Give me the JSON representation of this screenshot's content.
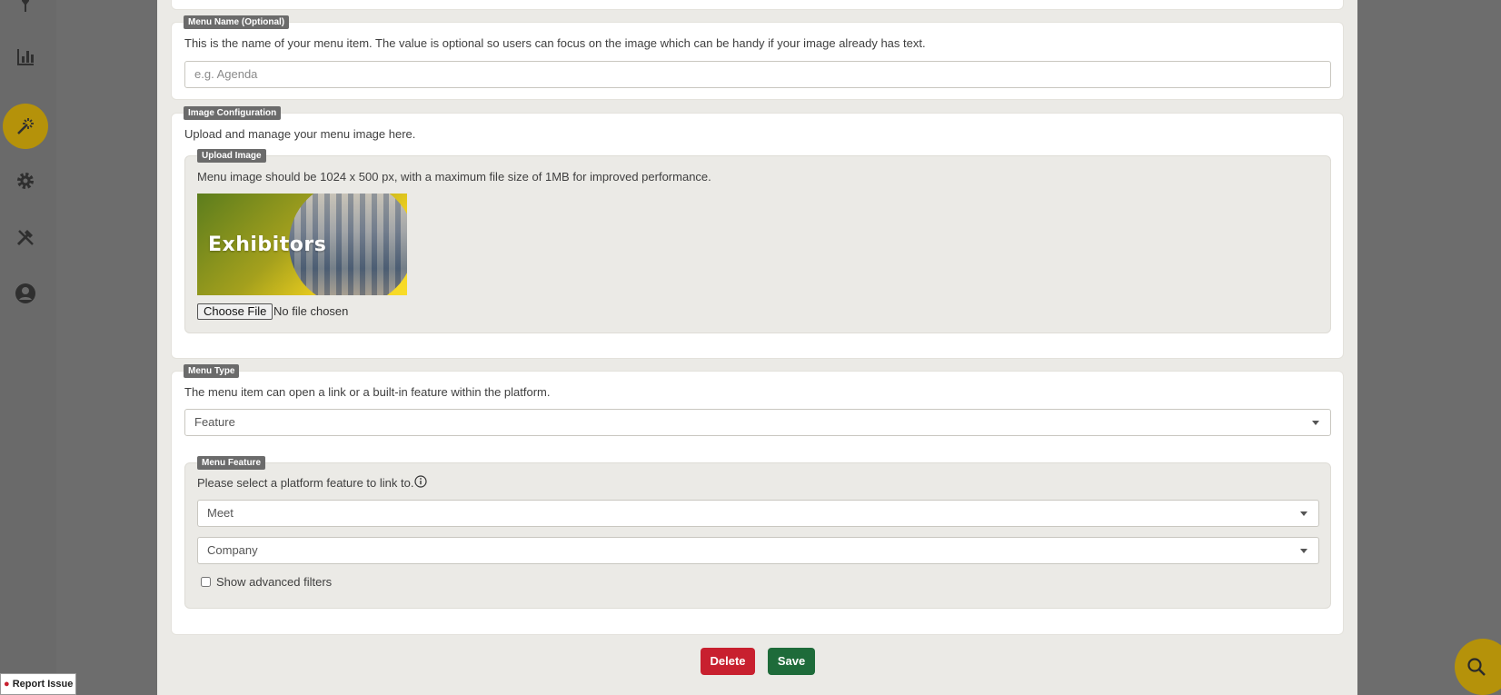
{
  "menu_name": {
    "legend": "Menu Name (Optional)",
    "description": "This is the name of your menu item. The value is optional so users can focus on the image which can be handy if your image already has text.",
    "placeholder": "e.g. Agenda"
  },
  "image_config": {
    "legend": "Image Configuration",
    "description": "Upload and manage your menu image here.",
    "upload": {
      "legend": "Upload Image",
      "description": "Menu image should be 1024 x 500 px, with a maximum file size of 1MB for improved performance.",
      "image_text": "Exhibitors",
      "choose_file_label": "Choose File",
      "file_status": "No file chosen"
    }
  },
  "menu_type": {
    "legend": "Menu Type",
    "description": "The menu item can open a link or a built-in feature within the platform.",
    "selected": "Feature"
  },
  "menu_feature": {
    "legend": "Menu Feature",
    "description": "Please select a platform feature to link to.",
    "feature_selected": "Meet",
    "target_selected": "Company",
    "advanced_filters_label": "Show advanced filters"
  },
  "actions": {
    "delete_label": "Delete",
    "save_label": "Save"
  },
  "report_issue_label": "Report Issue",
  "colors": {
    "accent": "#b5920a",
    "danger": "#c8202f",
    "success": "#1e6b3a"
  },
  "sidebar": {
    "icons": [
      "chart-bar-icon",
      "magic-wand-icon",
      "gear-icon",
      "tools-icon",
      "user-circle-icon"
    ]
  }
}
